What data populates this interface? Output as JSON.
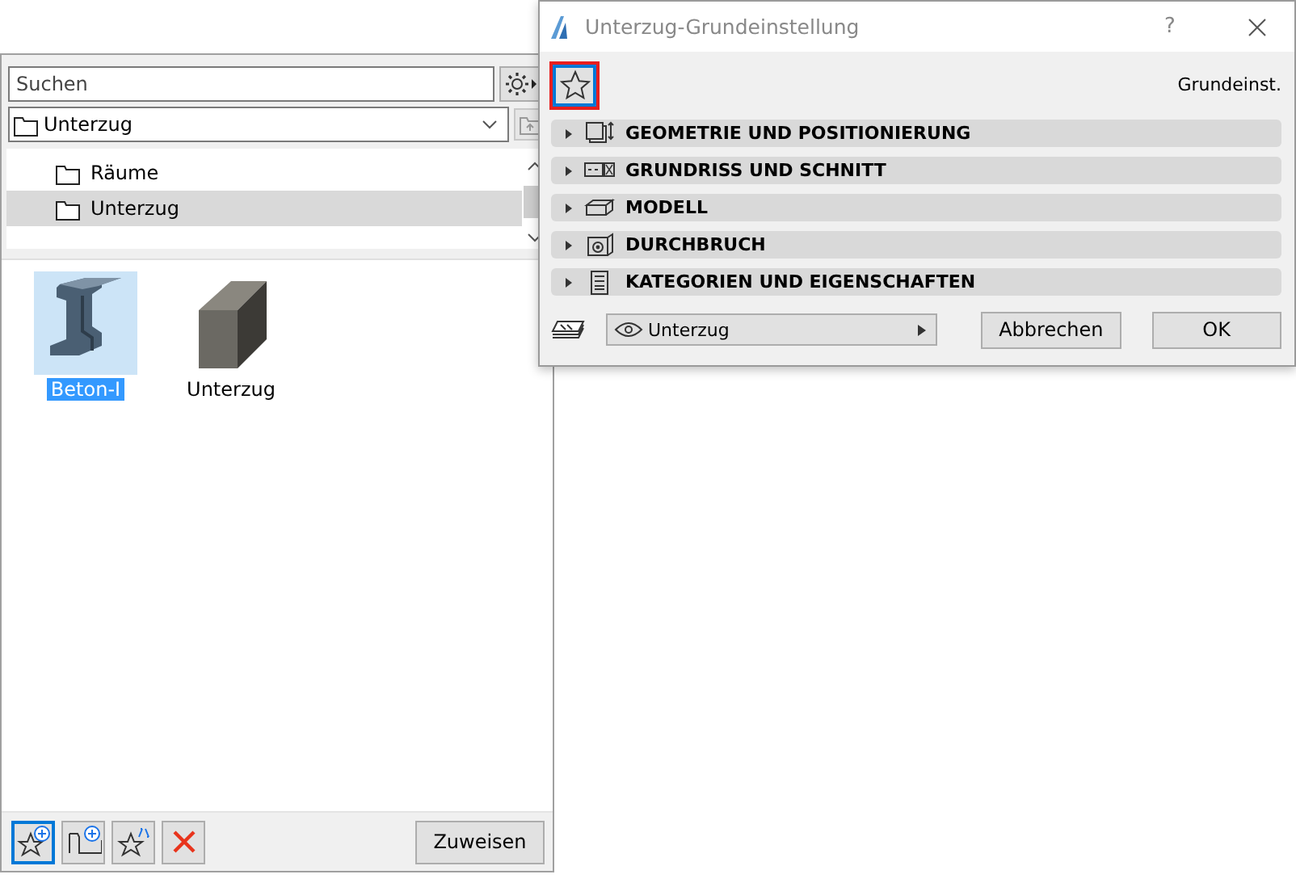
{
  "library_panel": {
    "search": {
      "placeholder": "Suchen"
    },
    "folder_dropdown": {
      "value": "Unterzug"
    },
    "tree": [
      {
        "label": "Räume",
        "selected": false
      },
      {
        "label": "Unterzug",
        "selected": true
      }
    ],
    "items": [
      {
        "label": "Beton-I",
        "kind": "i-beam",
        "selected": true
      },
      {
        "label": "Unterzug",
        "kind": "block",
        "selected": false
      }
    ],
    "tool_buttons": [
      {
        "kind": "new-favorite",
        "selected": true
      },
      {
        "kind": "new-folder",
        "selected": false
      },
      {
        "kind": "redefine-favorite",
        "selected": false
      },
      {
        "kind": "delete",
        "selected": false
      }
    ],
    "assign_button": "Zuweisen"
  },
  "dialog": {
    "title": "Unterzug-Grundeinstellung",
    "help": "?",
    "favorites_highlighted": true,
    "preset_label": "Grundeinst.",
    "sections": [
      {
        "label": "GEOMETRIE UND POSITIONIERUNG",
        "kind": "geometry",
        "expanded": false
      },
      {
        "label": "GRUNDRISS UND SCHNITT",
        "kind": "plan",
        "expanded": false
      },
      {
        "label": "MODELL",
        "kind": "model",
        "expanded": false
      },
      {
        "label": "DURCHBRUCH",
        "kind": "hole",
        "expanded": false
      },
      {
        "label": "KATEGORIEN UND EIGENSCHAFTEN",
        "kind": "categories",
        "expanded": false
      }
    ],
    "layer_dropdown": {
      "value": "Unterzug"
    },
    "buttons": [
      "Abbrechen",
      "OK"
    ]
  }
}
